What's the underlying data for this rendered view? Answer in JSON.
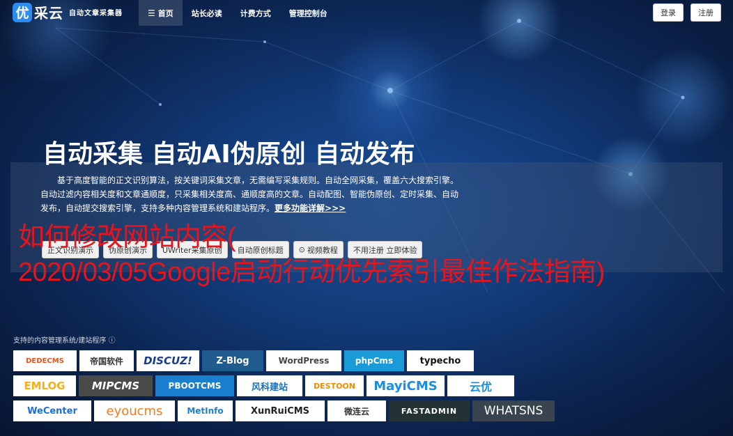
{
  "nav": {
    "logo_char": "优",
    "logo_text": "采云",
    "logo_sub": "自动文章采集器",
    "items": [
      {
        "label": "首页",
        "icon": "list-icon"
      },
      {
        "label": "站长必读"
      },
      {
        "label": "计费方式"
      },
      {
        "label": "管理控制台"
      }
    ],
    "login": "登录",
    "register": "注册"
  },
  "hero": {
    "title": "自动采集 自动AI伪原创 自动发布",
    "desc_line1": "基于高度智能的正文识别算法，按关键词采集文章，无需编写采集规则。自动全网采集，覆盖六大搜索引擎。自动过滤内容相关度和文章通顺度，只采集相关度高、通顺度高的文章。自动配图、智能伪原创、定时采集、自动发布，自动提交搜索引擎，支持多种内容管理系统和建站程序。",
    "more_link": "更多功能详解>>>",
    "buttons": [
      "正文识别演示",
      "伪原创演示",
      "UWriter采集原创",
      "自动原创标题",
      "视频教程",
      "不用注册 立即体验"
    ]
  },
  "overlay": {
    "line1": "如何修改网站内容(",
    "line2": "2020/03/05Google启动行动优先索引最佳作法指南)"
  },
  "cms": {
    "label": "支持的内容管理系统/建站程序",
    "row1": [
      "DEDECMS",
      "帝国软件",
      "DISCUZ!",
      "Z-Blog",
      "WordPress",
      "phpCms",
      "typecho"
    ],
    "row2": [
      "EMLOG",
      "MIPCMS",
      "PBOOTCMS",
      "风科建站",
      "DESTOON",
      "MayiCMS",
      "云优"
    ],
    "row3": [
      "WeCenter",
      "eyoucms",
      "MetInfo",
      "XunRuiCMS",
      "微连云",
      "FASTADMIN",
      "WHATSNS"
    ]
  }
}
